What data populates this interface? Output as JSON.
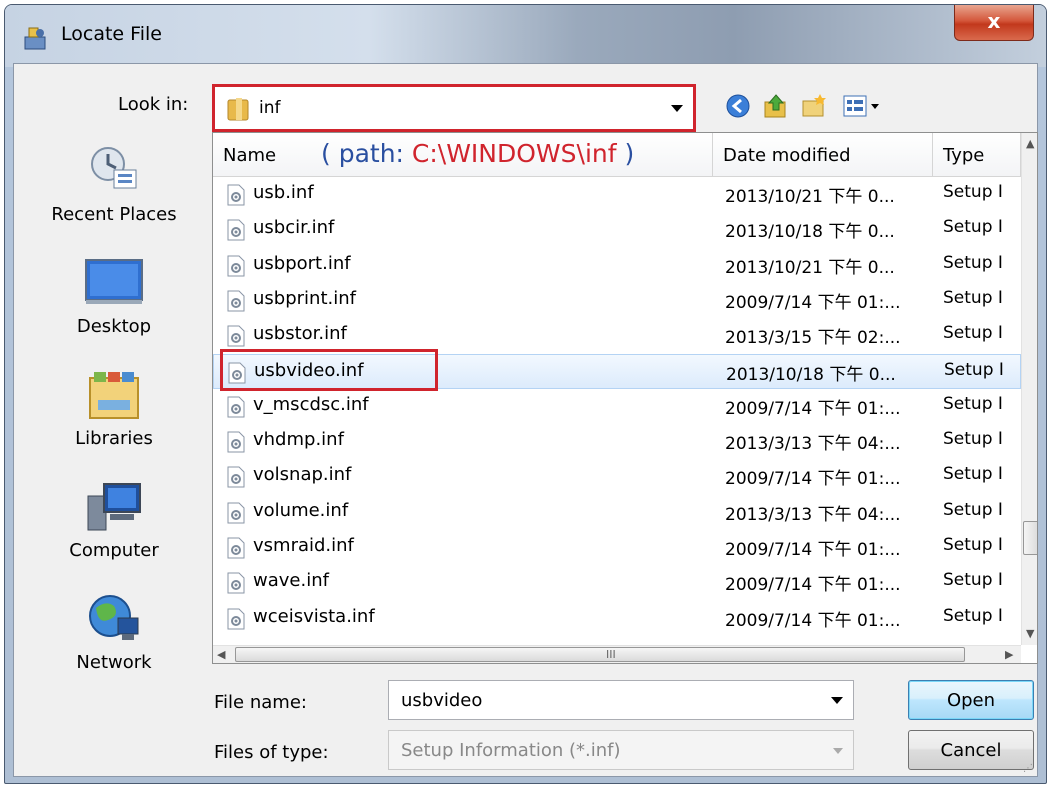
{
  "window": {
    "title": "Locate File",
    "close_label": "x"
  },
  "lookin": {
    "label": "Look in:",
    "value": "inf"
  },
  "toolbar": {
    "icons": [
      "back-icon",
      "up-folder-icon",
      "new-folder-icon",
      "view-menu-icon"
    ]
  },
  "places": [
    {
      "label": "Recent Places",
      "icon": "recent-places-icon"
    },
    {
      "label": "Desktop",
      "icon": "desktop-icon"
    },
    {
      "label": "Libraries",
      "icon": "libraries-icon"
    },
    {
      "label": "Computer",
      "icon": "computer-icon"
    },
    {
      "label": "Network",
      "icon": "network-icon"
    }
  ],
  "list": {
    "columns": {
      "name": "Name",
      "date": "Date modified",
      "type": "Type"
    },
    "annotation": {
      "prefix": "( path: ",
      "path": "C:\\WINDOWS\\inf",
      "suffix": " )"
    },
    "rows": [
      {
        "name": "usb.inf",
        "date": "2013/10/21 下午 0...",
        "type": "Setup I"
      },
      {
        "name": "usbcir.inf",
        "date": "2013/10/18 下午 0...",
        "type": "Setup I"
      },
      {
        "name": "usbport.inf",
        "date": "2013/10/21 下午 0...",
        "type": "Setup I"
      },
      {
        "name": "usbprint.inf",
        "date": "2009/7/14 下午 01:...",
        "type": "Setup I"
      },
      {
        "name": "usbstor.inf",
        "date": "2013/3/15 下午 02:...",
        "type": "Setup I"
      },
      {
        "name": "usbvideo.inf",
        "date": "2013/10/18 下午 0...",
        "type": "Setup I",
        "selected": true
      },
      {
        "name": "v_mscdsc.inf",
        "date": "2009/7/14 下午 01:...",
        "type": "Setup I"
      },
      {
        "name": "vhdmp.inf",
        "date": "2013/3/13 下午 04:...",
        "type": "Setup I"
      },
      {
        "name": "volsnap.inf",
        "date": "2009/7/14 下午 01:...",
        "type": "Setup I"
      },
      {
        "name": "volume.inf",
        "date": "2013/3/13 下午 04:...",
        "type": "Setup I"
      },
      {
        "name": "vsmraid.inf",
        "date": "2009/7/14 下午 01:...",
        "type": "Setup I"
      },
      {
        "name": "wave.inf",
        "date": "2009/7/14 下午 01:...",
        "type": "Setup I"
      },
      {
        "name": "wceisvista.inf",
        "date": "2009/7/14 下午 01:...",
        "type": "Setup I"
      }
    ],
    "hscroll_grip": "III"
  },
  "filename": {
    "label": "File name:",
    "value": "usbvideo"
  },
  "filetype": {
    "label": "Files of type:",
    "value": "Setup Information (*.inf)"
  },
  "buttons": {
    "open": "Open",
    "cancel": "Cancel"
  },
  "colors": {
    "highlight_red": "#d0242d",
    "annotation_blue": "#2a4fa0",
    "selection": "#dcebfc"
  }
}
